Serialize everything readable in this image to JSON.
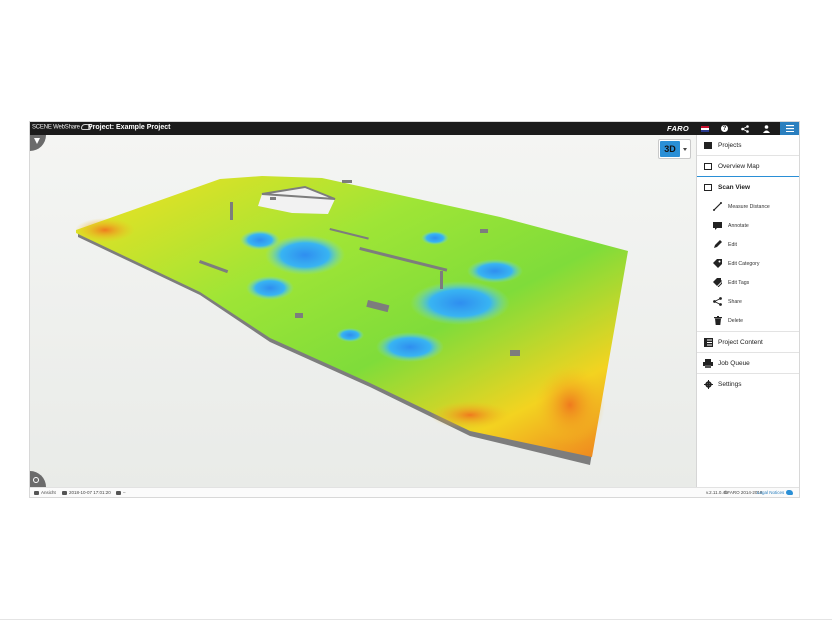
{
  "window": {
    "logo_text": "SCENE WebShare",
    "project_title": "Project: Example Project",
    "brand": "FARO"
  },
  "toolbar": {
    "icons": [
      "flag-icon",
      "help-icon",
      "share-icon",
      "user-icon",
      "menu-icon"
    ],
    "help_glyph": "?"
  },
  "viewport": {
    "view_mode": "3D",
    "colors": {
      "scan_low": "#30b8f0",
      "scan_mid": "#7fe040",
      "scan_high": "#f5e020",
      "scan_max": "#ef7a1e",
      "wall": "#7a7a7a"
    }
  },
  "sidebar": {
    "items": [
      {
        "label": "Projects",
        "icon": "projects-icon"
      },
      {
        "label": "Overview Map",
        "icon": "map-icon"
      }
    ],
    "scan_view": {
      "label": "Scan View",
      "icon": "scan-view-icon",
      "tools": [
        {
          "label": "Measure Distance",
          "icon": "measure-icon"
        },
        {
          "label": "Annotate",
          "icon": "annotate-icon"
        },
        {
          "label": "Edit",
          "icon": "pencil-icon"
        },
        {
          "label": "Edit Category",
          "icon": "category-icon"
        },
        {
          "label": "Edit Tags",
          "icon": "tags-icon"
        },
        {
          "label": "Share",
          "icon": "share-icon"
        },
        {
          "label": "Delete",
          "icon": "trash-icon"
        }
      ]
    },
    "bottom_items": [
      {
        "label": "Project Content",
        "icon": "content-icon"
      },
      {
        "label": "Job Queue",
        "icon": "queue-icon"
      },
      {
        "label": "Settings",
        "icon": "gear-icon"
      }
    ],
    "accent": "#2a8fd6"
  },
  "statusbar": {
    "scan_name": "Ansicht",
    "timestamp": "2018-10-07 17:01:20",
    "tag_value": "–",
    "version": "v.2.11.0.45",
    "copyright": "©FARO 2014-2018",
    "legal": "Legal Notices"
  }
}
